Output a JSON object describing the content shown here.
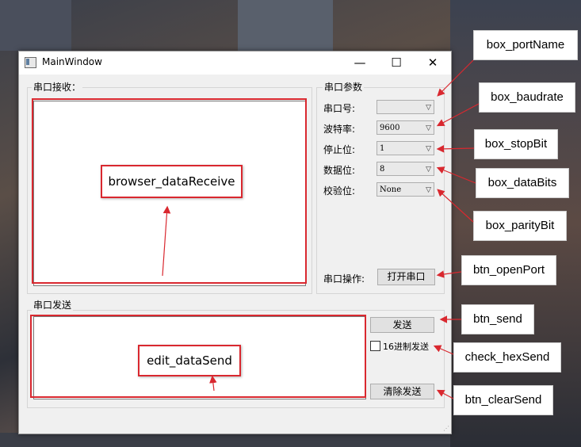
{
  "window": {
    "title": "MainWindow",
    "minimize": "—",
    "maximize": "☐",
    "close": "✕"
  },
  "receive_group": {
    "title": "串口接收：",
    "widget_label": "browser_dataReceive"
  },
  "params_group": {
    "title": "串口参数",
    "port_label": "串口号:",
    "port_value": "",
    "baud_label": "波特率:",
    "baud_value": "9600",
    "stop_label": "停止位:",
    "stop_value": "1",
    "data_label": "数据位:",
    "data_value": "8",
    "parity_label": "校验位:",
    "parity_value": "None",
    "op_label": "串口操作:",
    "open_button": "打开串口"
  },
  "send_group": {
    "title": "串口发送",
    "widget_label": "edit_dataSend",
    "send_button": "发送",
    "hex_checkbox": "16进制发送",
    "hex_checked": false,
    "clear_button": "清除发送"
  },
  "callouts": {
    "portName": "box_portName",
    "baudrate": "box_baudrate",
    "stopBit": "box_stopBit",
    "dataBits": "box_dataBits",
    "parityBit": "box_parityBit",
    "openPort": "btn_openPort",
    "send": "btn_send",
    "hexSend": "check_hexSend",
    "clearSend": "btn_clearSend"
  },
  "colors": {
    "annotation_red": "#d9282f"
  }
}
